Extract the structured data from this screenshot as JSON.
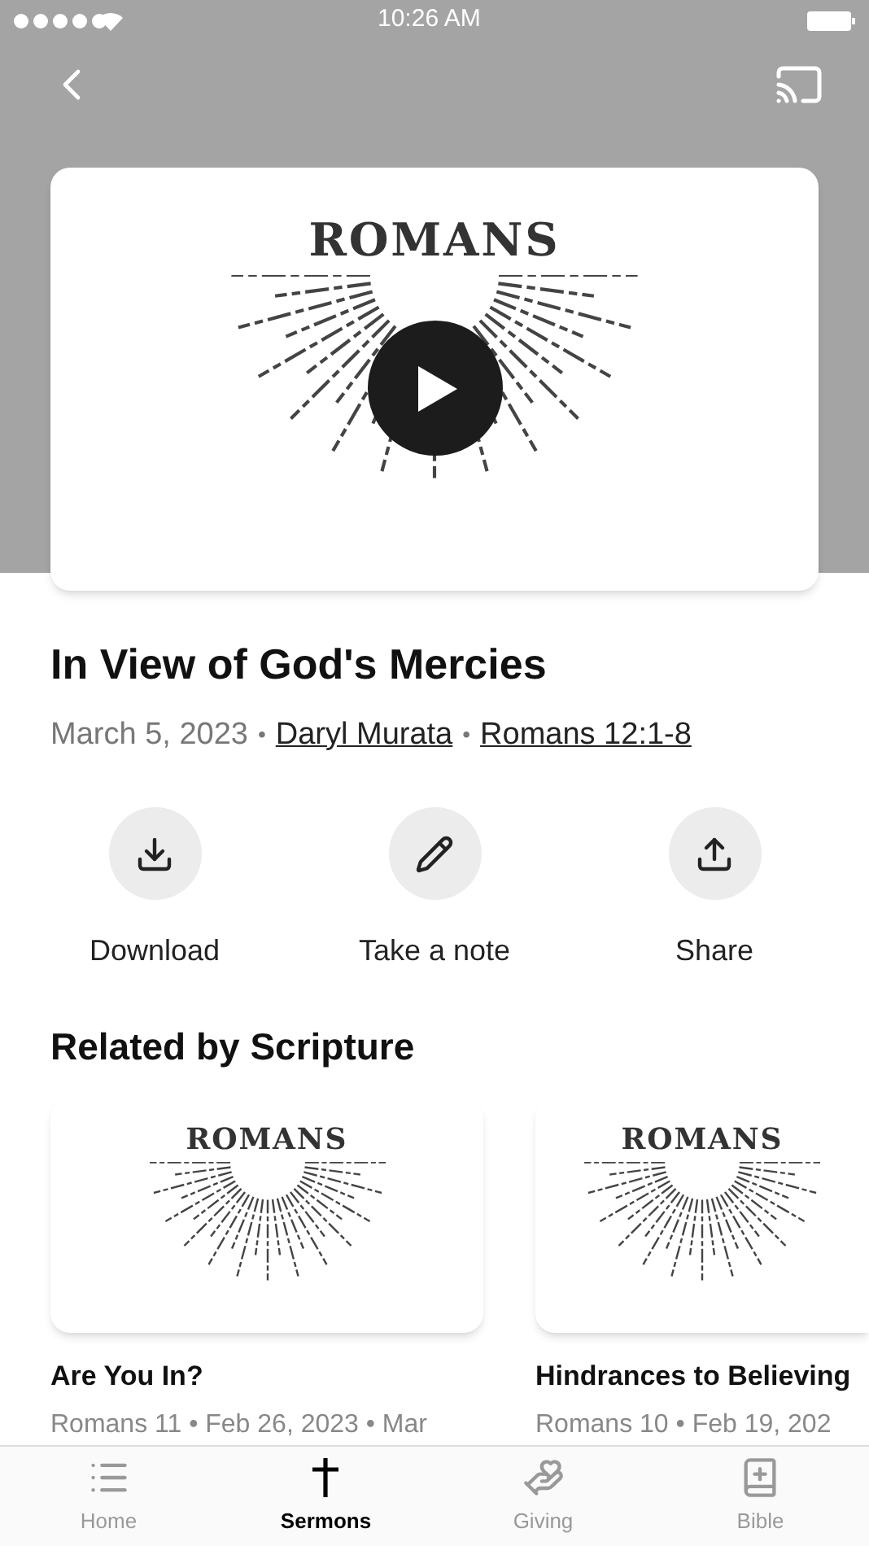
{
  "status_bar": {
    "time": "10:26 AM"
  },
  "hero": {
    "artwork_title": "ROMANS"
  },
  "sermon": {
    "title": "In View of God's Mercies",
    "meta": [
      {
        "kind": "text",
        "text": "March 5, 2023"
      },
      {
        "kind": "separator",
        "text": "•"
      },
      {
        "kind": "link",
        "text": "Daryl Murata"
      },
      {
        "kind": "separator",
        "text": "•"
      },
      {
        "kind": "link",
        "text": "Romans 12:1-8"
      }
    ]
  },
  "actions": [
    {
      "label": "Download"
    },
    {
      "label": "Take a note"
    },
    {
      "label": "Share"
    }
  ],
  "related": {
    "heading": "Related by Scripture",
    "items": [
      {
        "artwork_title": "ROMANS",
        "title": "Are You In?",
        "meta": "Romans 11 • Feb 26, 2023 • Mar"
      },
      {
        "artwork_title": "ROMANS",
        "title": "Hindrances to Believing",
        "meta": "Romans 10 • Feb 19, 202"
      }
    ]
  },
  "tabs": [
    {
      "label": "Home",
      "selected": false
    },
    {
      "label": "Sermons",
      "selected": true
    },
    {
      "label": "Giving",
      "selected": false
    },
    {
      "label": "Bible",
      "selected": false
    }
  ]
}
